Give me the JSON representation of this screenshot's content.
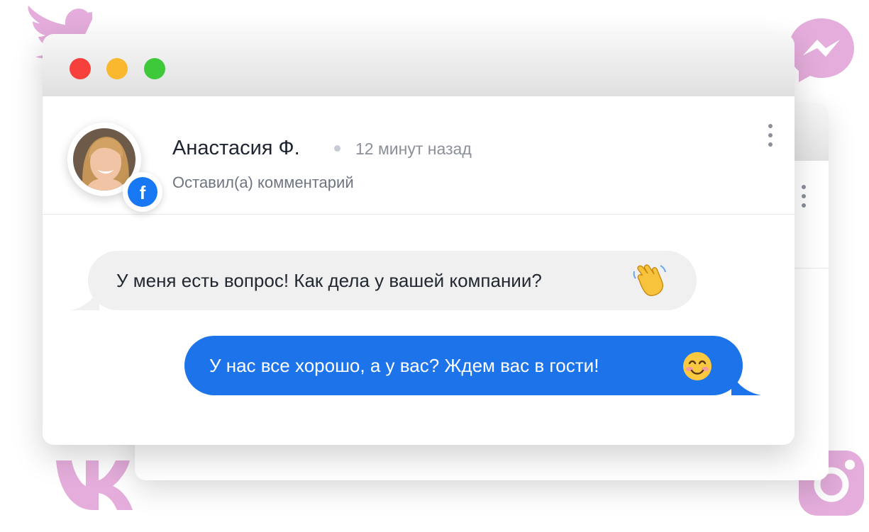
{
  "window": {
    "traffic_lights": [
      "close",
      "minimize",
      "maximize"
    ],
    "colors": {
      "red": "#f7403b",
      "yellow": "#f9b82d",
      "green": "#3ec93b"
    }
  },
  "post": {
    "author": "Анастасия Ф.",
    "time": "12 минут назад",
    "action": "Оставил(а) комментарий",
    "network_icon": "facebook-icon",
    "network_letter": "f"
  },
  "messages": [
    {
      "from": "user",
      "text": "У меня есть вопрос! Как дела у вашей компании?",
      "emoji": "waving-hand-emoji"
    },
    {
      "from": "business",
      "text": "У нас все хорошо, а у вас? Ждем вас в гости!",
      "emoji": "smiling-face-emoji"
    }
  ],
  "decorations": [
    "twitter-icon",
    "messenger-icon",
    "vk-icon",
    "instagram-icon"
  ],
  "colors": {
    "accent": "#1d74ea",
    "incoming_bubble": "#f0f0f0",
    "decor": "#e4addb"
  }
}
